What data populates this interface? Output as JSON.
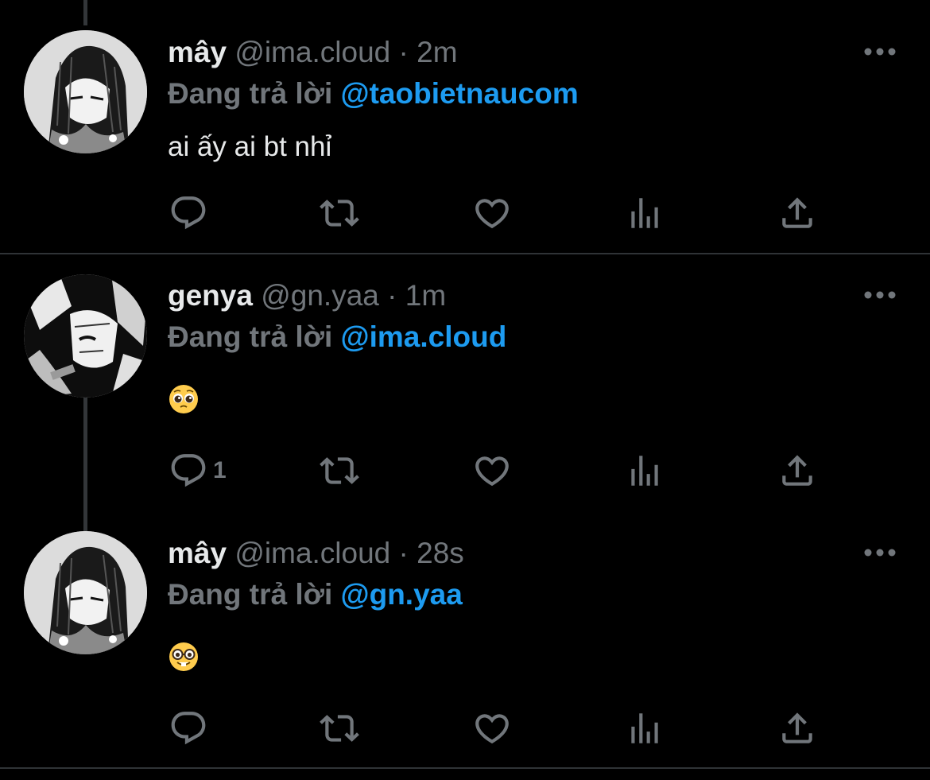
{
  "colors": {
    "background": "#000000",
    "name": "#e7e9ea",
    "muted": "#71767b",
    "mention": "#1d9bf0",
    "divider": "#2f3336"
  },
  "tweets": [
    {
      "name": "mây",
      "handle": "@ima.cloud",
      "separator": "·",
      "time": "2m",
      "reply_prefix": "Đang trả lời",
      "reply_to": "@taobietnaucom",
      "text": "ai ấy ai bt nhỉ",
      "reply_count": ""
    },
    {
      "name": "genya",
      "handle": "@gn.yaa",
      "separator": "·",
      "time": "1m",
      "reply_prefix": "Đang trả lời",
      "reply_to": "@ima.cloud",
      "text": "🥹",
      "reply_count": "1"
    },
    {
      "name": "mây",
      "handle": "@ima.cloud",
      "separator": "·",
      "time": "28s",
      "reply_prefix": "Đang trả lời",
      "reply_to": "@gn.yaa",
      "text": "🤓",
      "reply_count": ""
    }
  ],
  "icons": {
    "reply": "reply-icon",
    "retweet": "retweet-icon",
    "like": "heart-icon",
    "views": "views-icon",
    "share": "share-icon",
    "more": "more-icon"
  }
}
